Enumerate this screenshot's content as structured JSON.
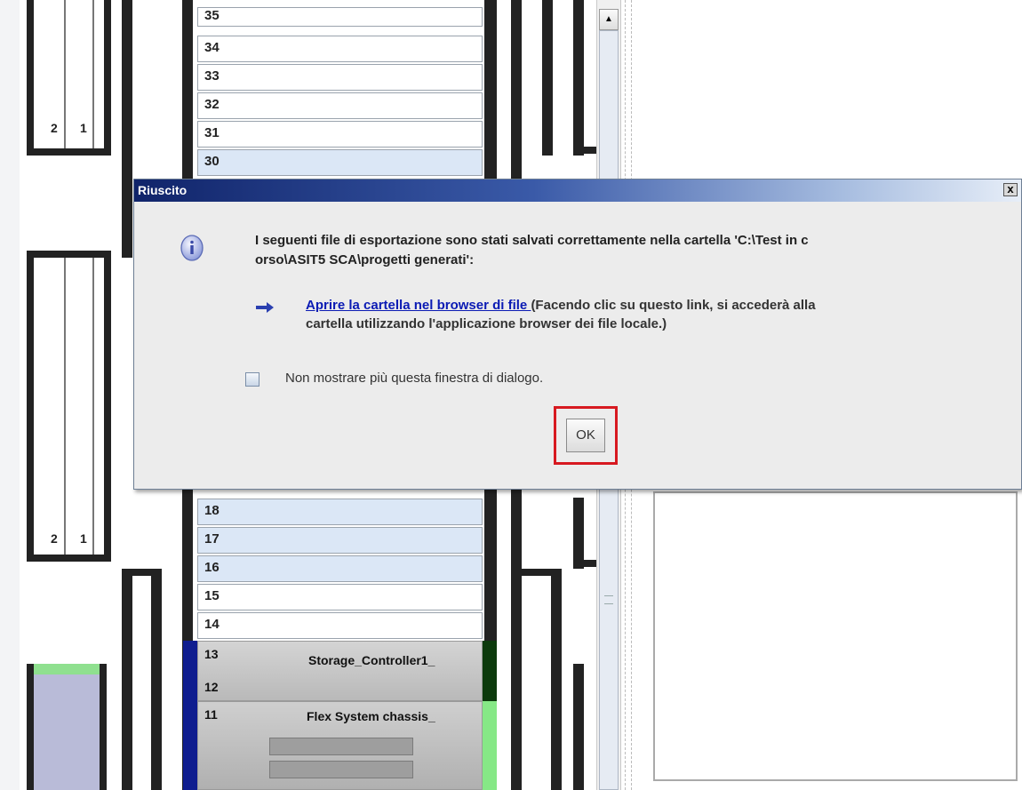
{
  "rack": {
    "slots_top": [
      "35",
      "34",
      "33",
      "32",
      "31",
      "30"
    ],
    "slots_bottom": [
      "18",
      "17",
      "16",
      "15",
      "14",
      "13",
      "12",
      "11"
    ],
    "rail_numbers": {
      "a": "2",
      "b": "1"
    },
    "devices": {
      "storage": "Storage_Controller1_",
      "chassis": "Flex System chassis_"
    }
  },
  "dialog": {
    "title": "Riuscito",
    "close_label": "x",
    "message_line1": "I seguenti file di esportazione sono stati salvati correttamente nella cartella 'C:\\Test in c",
    "message_line2": "orso\\ASIT5 SCA\\progetti generati':",
    "link_text": "Aprire la cartella nel browser di file ",
    "link_note": "(Facendo clic su questo link, si accederà alla",
    "link_note2": "cartella utilizzando l'applicazione browser dei file locale.)",
    "checkbox_label": "Non mostrare più questa finestra di dialogo.",
    "ok_label": "OK"
  },
  "icons": {
    "info": "info-icon",
    "arrow": "right-arrow-icon",
    "scroll_up": "scroll-up-icon"
  }
}
